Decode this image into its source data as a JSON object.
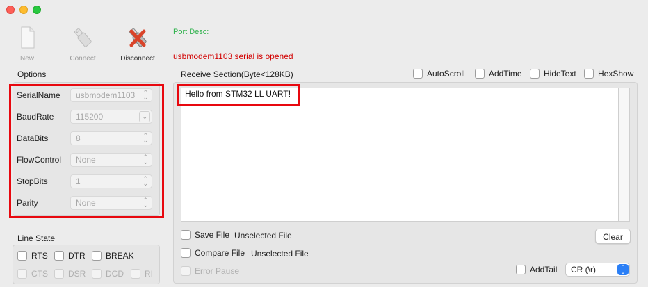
{
  "toolbar": {
    "new_label": "New",
    "connect_label": "Connect",
    "disconnect_label": "Disconnect"
  },
  "port_desc": "Port Desc:",
  "status_message": "usbmodem1103 serial is opened",
  "options": {
    "title": "Options",
    "rows": [
      {
        "key": "SerialName",
        "value": "usbmodem1103"
      },
      {
        "key": "BaudRate",
        "value": "115200"
      },
      {
        "key": "DataBits",
        "value": "8"
      },
      {
        "key": "FlowControl",
        "value": "None"
      },
      {
        "key": "StopBits",
        "value": "1"
      },
      {
        "key": "Parity",
        "value": "None"
      }
    ]
  },
  "line_state": {
    "title": "Line State",
    "rts": "RTS",
    "dtr": "DTR",
    "break": "BREAK",
    "cts": "CTS",
    "dsr": "DSR",
    "dcd": "DCD",
    "ri": "RI"
  },
  "receive": {
    "title": "Receive Section(Byte<128KB)",
    "autoscroll": "AutoScroll",
    "addtime": "AddTime",
    "hidetext": "HideText",
    "hexshow": "HexShow",
    "content": "Hello from STM32 LL UART!",
    "save_file": "Save File",
    "save_file_value": "Unselected File",
    "compare_file": "Compare File",
    "compare_file_value": "Unselected File",
    "error_pause": "Error Pause",
    "clear": "Clear",
    "addtail": "AddTail",
    "tail_value": "CR (\\r)"
  },
  "colors": {
    "highlight": "#e8080f",
    "port_desc": "#2fb24c",
    "status": "#d20000",
    "select_accent": "#2b7ff6"
  }
}
